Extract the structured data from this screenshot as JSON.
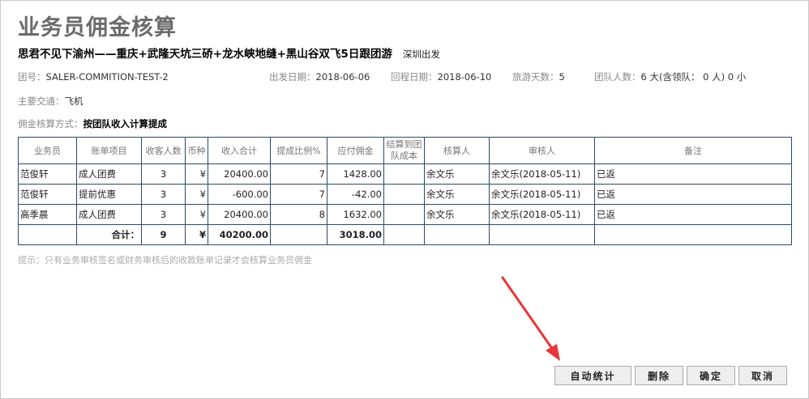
{
  "page": {
    "title": "业务员佣金核算",
    "trip_name": "思君不见下渝州——重庆+武隆天坑三硚+龙水峡地缝+黑山谷双飞5日跟团游",
    "trip_origin": "深圳出发"
  },
  "info": {
    "group_no_label": "团号：",
    "group_no": "SALER-COMMITION-TEST-2",
    "depart_label": "出发日期：",
    "depart_date": "2018-06-06",
    "return_label": "回程日期：",
    "return_date": "2018-06-10",
    "days_label": "旅游天数：",
    "days": "5",
    "people_label": "团队人数：",
    "people": "6 大(含领队： 0 人) 0 小",
    "transport_label": "主要交通：",
    "transport": "飞机",
    "method_label": "佣金核算方式：",
    "method": "按团队收入计算提成"
  },
  "table": {
    "headers": [
      "业务员",
      "账单项目",
      "收客人数",
      "币种",
      "收入合计",
      "提成比例%",
      "应付佣金",
      "结算到团队成本",
      "核算人",
      "审核人",
      "备注"
    ],
    "rows": [
      {
        "salesperson": "范俊轩",
        "item": "成人团费",
        "count": "3",
        "currency": "¥",
        "income": "20400.00",
        "rate": "7",
        "commission": "1428.00",
        "cost": "",
        "accountant": "余文乐",
        "auditor": "余文乐(2018-05-11)",
        "note": "已返"
      },
      {
        "salesperson": "范俊轩",
        "item": "提前优惠",
        "count": "3",
        "currency": "¥",
        "income": "-600.00",
        "rate": "7",
        "commission": "-42.00",
        "cost": "",
        "accountant": "余文乐",
        "auditor": "余文乐(2018-05-11)",
        "note": "已返"
      },
      {
        "salesperson": "高季晨",
        "item": "成人团费",
        "count": "3",
        "currency": "¥",
        "income": "20400.00",
        "rate": "8",
        "commission": "1632.00",
        "cost": "",
        "accountant": "余文乐",
        "auditor": "余文乐(2018-05-11)",
        "note": "已返"
      }
    ],
    "total": {
      "label": "合计：",
      "count": "9",
      "currency": "¥",
      "income": "40200.00",
      "commission": "3018.00"
    }
  },
  "tip": "提示：只有业务审核签名或财务审核后的收款账单记录才会核算业务员佣金",
  "buttons": {
    "auto_stat": "自动统计",
    "delete": "删除",
    "confirm": "确定",
    "cancel": "取消"
  },
  "colors": {
    "title_gray": "#6b6b6b",
    "table_border": "#2c4a6e",
    "annotation_arrow": "#e8363a"
  }
}
